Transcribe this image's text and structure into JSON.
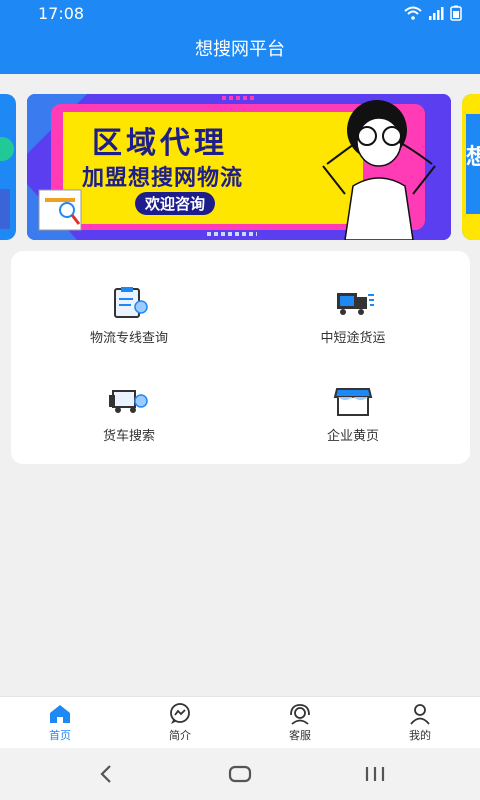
{
  "status_bar": {
    "time": "17:08",
    "icons": [
      "wifi-icon",
      "signal-icon",
      "battery-icon"
    ]
  },
  "header": {
    "title": "想搜网平台"
  },
  "banner": {
    "line1": "区域代理",
    "line2": "加盟想搜网物流",
    "line3": "欢迎咨询"
  },
  "menu": {
    "items": [
      {
        "label": "物流专线查询",
        "icon": "clipboard-icon"
      },
      {
        "label": "中短途货运",
        "icon": "fast-truck-icon"
      },
      {
        "label": "货车搜索",
        "icon": "truck-search-icon"
      },
      {
        "label": "企业黄页",
        "icon": "store-icon"
      }
    ]
  },
  "tabbar": {
    "tabs": [
      {
        "label": "首页",
        "icon": "home-icon",
        "active": true
      },
      {
        "label": "简介",
        "icon": "chat-icon",
        "active": false
      },
      {
        "label": "客服",
        "icon": "headset-icon",
        "active": false
      },
      {
        "label": "我的",
        "icon": "user-icon",
        "active": false
      }
    ]
  },
  "colors": {
    "primary": "#1e88f5",
    "banner_yellow": "#ffe600",
    "banner_navy": "#1d1d8c",
    "background": "#f0f0f0"
  }
}
